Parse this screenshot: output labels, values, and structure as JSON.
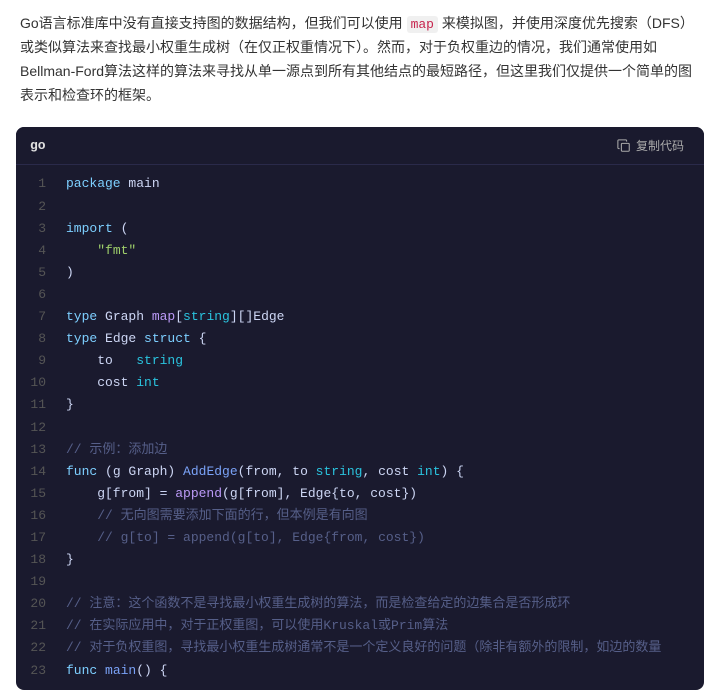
{
  "prose": {
    "text": "Go语言标准库中没有直接支持图的数据结构，但我们可以使用 map 来模拟图，并使用深度优先搜索（DFS）或类似算法来查找最小权重生成树（在仅正权重情况下）。然而，对于负权重边的情况，我们通常使用如Bellman-Ford算法这样的算法来寻找从单一源点到所有其他结点的最短路径，但这里我们仅提供一个简单的图表示和检查环的框架。",
    "inline_code": "map"
  },
  "code_block": {
    "language": "go",
    "copy_label": "复制代码",
    "lines": [
      {
        "num": 1,
        "tokens": [
          {
            "t": "package",
            "c": "kw-blue"
          },
          {
            "t": " main",
            "c": "plain"
          }
        ]
      },
      {
        "num": 2,
        "tokens": []
      },
      {
        "num": 3,
        "tokens": [
          {
            "t": "import",
            "c": "kw-blue"
          },
          {
            "t": " (",
            "c": "plain"
          }
        ]
      },
      {
        "num": 4,
        "tokens": [
          {
            "t": "    ",
            "c": "plain"
          },
          {
            "t": "\"fmt\"",
            "c": "kw-string"
          }
        ]
      },
      {
        "num": 5,
        "tokens": [
          {
            "t": ")",
            "c": "plain"
          }
        ]
      },
      {
        "num": 6,
        "tokens": []
      },
      {
        "num": 7,
        "tokens": [
          {
            "t": "type",
            "c": "kw-blue"
          },
          {
            "t": " Graph ",
            "c": "plain"
          },
          {
            "t": "map",
            "c": "kw-purple"
          },
          {
            "t": "[",
            "c": "plain"
          },
          {
            "t": "string",
            "c": "kw-type"
          },
          {
            "t": "][]Edge",
            "c": "plain"
          }
        ]
      },
      {
        "num": 8,
        "tokens": [
          {
            "t": "type",
            "c": "kw-blue"
          },
          {
            "t": " Edge ",
            "c": "plain"
          },
          {
            "t": "struct",
            "c": "kw-blue"
          },
          {
            "t": " {",
            "c": "plain"
          }
        ]
      },
      {
        "num": 9,
        "tokens": [
          {
            "t": "    to   ",
            "c": "plain"
          },
          {
            "t": "string",
            "c": "kw-type"
          }
        ]
      },
      {
        "num": 10,
        "tokens": [
          {
            "t": "    cost ",
            "c": "plain"
          },
          {
            "t": "int",
            "c": "kw-type"
          }
        ]
      },
      {
        "num": 11,
        "tokens": [
          {
            "t": "}",
            "c": "plain"
          }
        ]
      },
      {
        "num": 12,
        "tokens": []
      },
      {
        "num": 13,
        "tokens": [
          {
            "t": "// 示例：添加边",
            "c": "kw-comment"
          }
        ]
      },
      {
        "num": 14,
        "tokens": [
          {
            "t": "func",
            "c": "kw-blue"
          },
          {
            "t": " (g Graph) ",
            "c": "plain"
          },
          {
            "t": "AddEdge",
            "c": "kw-fn"
          },
          {
            "t": "(from, to ",
            "c": "plain"
          },
          {
            "t": "string",
            "c": "kw-type"
          },
          {
            "t": ", cost ",
            "c": "plain"
          },
          {
            "t": "int",
            "c": "kw-type"
          },
          {
            "t": ") {",
            "c": "plain"
          }
        ]
      },
      {
        "num": 15,
        "tokens": [
          {
            "t": "    g[from] = ",
            "c": "plain"
          },
          {
            "t": "append",
            "c": "kw-purple"
          },
          {
            "t": "(g[from], Edge{to, cost})",
            "c": "plain"
          }
        ]
      },
      {
        "num": 16,
        "tokens": [
          {
            "t": "    ",
            "c": "plain"
          },
          {
            "t": "// 无向图需要添加下面的行，但本例是有向图",
            "c": "kw-comment"
          }
        ]
      },
      {
        "num": 17,
        "tokens": [
          {
            "t": "    ",
            "c": "plain"
          },
          {
            "t": "// g[to] = append(g[to], Edge{from, cost})",
            "c": "kw-comment"
          }
        ]
      },
      {
        "num": 18,
        "tokens": [
          {
            "t": "}",
            "c": "plain"
          }
        ]
      },
      {
        "num": 19,
        "tokens": []
      },
      {
        "num": 20,
        "tokens": [
          {
            "t": "// 注意：这个函数不是寻找最小权重生成树的算法，而是检查给定的边集合是否形成环",
            "c": "kw-comment"
          }
        ]
      },
      {
        "num": 21,
        "tokens": [
          {
            "t": "// 在实际应用中，对于正权重图，可以使用Kruskal或Prim算法",
            "c": "kw-comment"
          }
        ]
      },
      {
        "num": 22,
        "tokens": [
          {
            "t": "// 对于负权重图，寻找最小权重生成树通常不是一个定义良好的问题（除非有额外的限制，如边的数量",
            "c": "kw-comment"
          }
        ]
      },
      {
        "num": 23,
        "tokens": [
          {
            "t": "func",
            "c": "kw-blue"
          },
          {
            "t": " ",
            "c": "plain"
          },
          {
            "t": "main",
            "c": "kw-fn"
          },
          {
            "t": "() {",
            "c": "plain"
          }
        ]
      }
    ]
  }
}
